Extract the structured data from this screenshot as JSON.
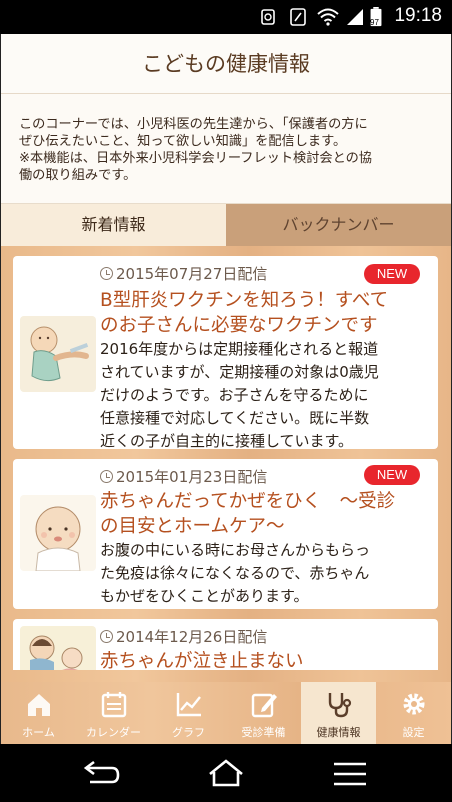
{
  "status_bar": {
    "time": "19:18",
    "battery_level": "97"
  },
  "header": {
    "title": "こどもの健康情報"
  },
  "intro": {
    "lines": [
      "このコーナーでは、小児科医の先生達から、「保護者の方に",
      "ぜひ伝えたいこと、知って欲しい知識」を配信します。",
      "※本機能は、日本外来小児科学会リーフレット検討会との協",
      "働の取り組みです。"
    ]
  },
  "tabs": {
    "latest": "新着情報",
    "back_numbers": "バックナンバー"
  },
  "articles": [
    {
      "date": "2015年07月27日配信",
      "badge": "NEW",
      "title_lines": [
        "B型肝炎ワクチンを知ろう！すべて",
        "のお子さんに必要なワクチンです"
      ],
      "body_lines": [
        "2016年度からは定期接種化されると報道",
        "されていますが、定期接種の対象は0歳児",
        "だけのようです。お子さんを守るために",
        "任意接種で対応してください。既に半数",
        "近くの子が自主的に接種しています。"
      ]
    },
    {
      "date": "2015年01月23日配信",
      "badge": "NEW",
      "title_lines": [
        "赤ちゃんだってかぜをひく　～受診",
        "の目安とホームケア～"
      ],
      "body_lines": [
        "お腹の中にいる時にお母さんからもらっ",
        "た免疫は徐々になくなるので、赤ちゃん",
        "もかぜをひくことがあります。"
      ]
    },
    {
      "date": "2014年12月26日配信",
      "title_lines": [
        "赤ちゃんが泣き止まない"
      ]
    }
  ],
  "bottom_nav": {
    "items": [
      {
        "label": "ホーム",
        "icon": "home-icon"
      },
      {
        "label": "カレンダー",
        "icon": "calendar-icon"
      },
      {
        "label": "グラフ",
        "icon": "graph-icon"
      },
      {
        "label": "受診準備",
        "icon": "pencil-icon"
      },
      {
        "label": "健康情報",
        "icon": "stethoscope-icon"
      },
      {
        "label": "設定",
        "icon": "gear-icon"
      }
    ],
    "active": "健康情報"
  },
  "colors": {
    "accent": "#b5501f",
    "badge": "#e8262d",
    "wood": "#ecbd90"
  }
}
